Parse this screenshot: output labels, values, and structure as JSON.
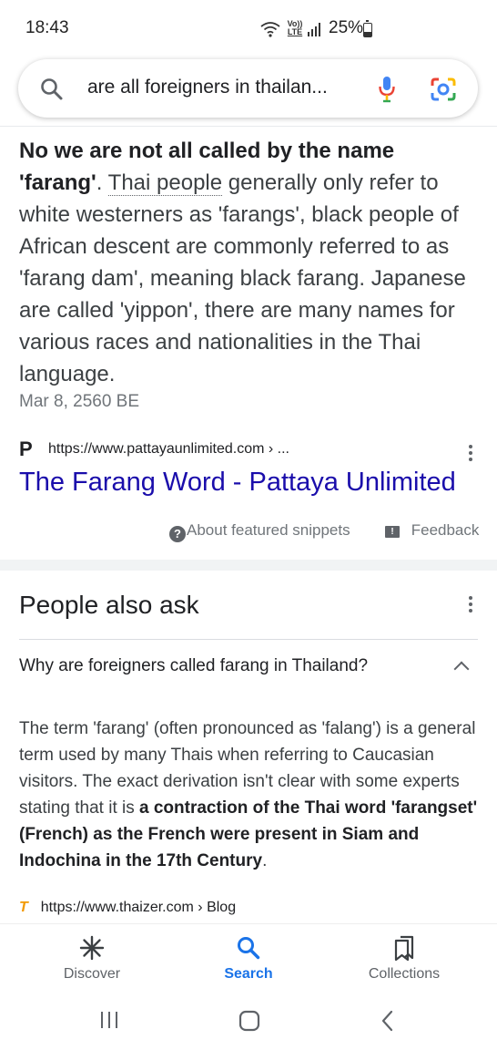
{
  "status_bar": {
    "time": "18:43",
    "network_badge_top": "Vo))",
    "network_badge_bottom": "LTE",
    "battery": "25%"
  },
  "search": {
    "query": "are all foreigners in thailan...",
    "icons": [
      "search-icon",
      "mic-icon",
      "lens-icon"
    ]
  },
  "snippet": {
    "bold_text": "No we are not all called by the name 'farang'",
    "after_bold": ". ",
    "linked_term": "Thai people",
    "rest": " generally only refer to white westerners as 'farangs', black people of African descent are commonly referred to as 'farang dam', meaning black farang. Japanese are called 'yippon', there are many names for various races and nationalities in the Thai language.",
    "date": "Mar 8, 2560 BE",
    "favicon_letter": "P",
    "url": "https://www.pattayaunlimited.com › ...",
    "result_title": "The Farang Word - Pattaya Unlimited",
    "about_label": "About featured snippets",
    "feedback_label": "Feedback"
  },
  "people_also_ask": {
    "title": "People also ask",
    "question": "Why are foreigners called farang in Thailand?",
    "answer_intro": "The term 'farang' (often pronounced as 'falang') is a general term used by many Thais when referring to Caucasian visitors. The exact derivation isn't clear with some experts stating that it is ",
    "answer_bold": "a contraction of the Thai word 'farangset' (French) as the French were present in Siam and Indochina in the 17th Century",
    "answer_end": ".",
    "source_url": "https://www.thaizer.com › Blog",
    "source_favicon": "T"
  },
  "bottom_nav": {
    "items": [
      {
        "label": "Discover",
        "icon": "asterisk-icon"
      },
      {
        "label": "Search",
        "icon": "search-icon"
      },
      {
        "label": "Collections",
        "icon": "bookmarks-icon"
      }
    ],
    "active": "Search"
  },
  "colors": {
    "link_blue": "#1a0dab",
    "accent_blue": "#1a73e8",
    "text": "#202124",
    "secondary_text": "#70757a"
  }
}
